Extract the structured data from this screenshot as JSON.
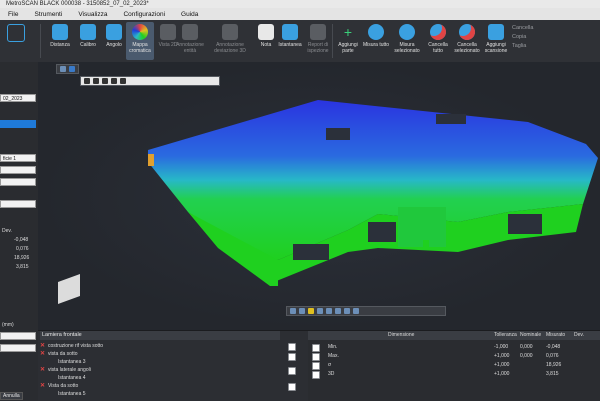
{
  "window": {
    "title": "MetroSCAN BLACK 000038 - 3150852_07_02_2023*"
  },
  "menu": [
    "File",
    "Strumenti",
    "Visualizza",
    "Configurazioni",
    "Guida"
  ],
  "ribbon": {
    "buttons": [
      {
        "label": "Distanza",
        "color": "#3aa0e0"
      },
      {
        "label": "Calibro",
        "color": "#3aa0e0"
      },
      {
        "label": "Angolo",
        "color": "#3aa0e0"
      },
      {
        "label": "Mappa cromatica",
        "color": "#e0b030",
        "active": true
      },
      {
        "label": "Vista 2D",
        "color": "#7a7d82",
        "dim": true
      },
      {
        "label": "Annotazione entità",
        "color": "#7a7d82",
        "dim": true
      },
      {
        "label": "Annotazione deviazione 3D",
        "color": "#7a7d82",
        "dim": true
      },
      {
        "label": "Nota",
        "color": "#e8e8e8"
      },
      {
        "label": "Istantanea",
        "color": "#3aa0e0"
      },
      {
        "label": "Report di ispezione",
        "color": "#7a7d82",
        "dim": true
      },
      {
        "label": "Aggiungi parte",
        "color": "#3ad07a"
      },
      {
        "label": "Misura tutto",
        "color": "#3aa0e0"
      },
      {
        "label": "Misura selezionato",
        "color": "#3aa0e0"
      },
      {
        "label": "Cancella tutto",
        "color": "#e04444"
      },
      {
        "label": "Cancella selezionato",
        "color": "#e04444"
      },
      {
        "label": "Aggiungi scansione",
        "color": "#3aa0e0"
      }
    ],
    "edit_items": [
      "Cancella",
      "Copia",
      "Taglia"
    ]
  },
  "left_panel": {
    "rows": [
      {
        "text": "02_2023",
        "style": "white"
      },
      {
        "text": "",
        "style": "blue"
      },
      {
        "text": "ficie 1",
        "style": "white"
      },
      {
        "text": "",
        "style": "white"
      },
      {
        "text": "",
        "style": "white"
      },
      {
        "text": "",
        "style": "white"
      }
    ],
    "dev_header": "Dev.",
    "dev_values": [
      "-0,048",
      "0,076",
      "18,926",
      "3,815"
    ],
    "unit_label": "(mm)",
    "buttons": [
      "Annulla"
    ]
  },
  "viewport": {
    "top_toolbar_icons": [
      "view-icon",
      "cube-icon"
    ],
    "bottom_toolbar_icons": [
      "rotate-icon",
      "cube-icon",
      "shade-icon",
      "grid-icon",
      "camera-icon",
      "light-icon",
      "layers-icon",
      "eye-icon"
    ],
    "color_map": {
      "blue": "#1f3fd8",
      "cyan": "#2bb8c8",
      "green": "#1fd01f",
      "yellow": "#e0c020"
    }
  },
  "tree": {
    "title": "Lamiera frontale",
    "items": [
      {
        "label": "costruzione rif vista sotto"
      },
      {
        "label": "vista da sotto"
      },
      {
        "label": "Istantanea 3"
      },
      {
        "label": "vista laterale angoli"
      },
      {
        "label": "Istantanea 4"
      },
      {
        "label": "Vista da sotto"
      },
      {
        "label": "Istantanea 5"
      }
    ]
  },
  "table": {
    "headers": [
      "Dimensione",
      "Tolleranza",
      "Nominale",
      "Misurato",
      "Dev."
    ],
    "rows": [
      {
        "dim": "Min.",
        "tol": "-1,000",
        "nom": "0,000",
        "mis": "-0,048"
      },
      {
        "dim": "Max.",
        "tol": "+1,000",
        "nom": "0,000",
        "mis": "0,076"
      },
      {
        "dim": "σ",
        "tol": "+1,000",
        "nom": "",
        "mis": "18,926"
      },
      {
        "dim": "3D",
        "tol": "+1,000",
        "nom": "",
        "mis": "3,815"
      }
    ]
  }
}
